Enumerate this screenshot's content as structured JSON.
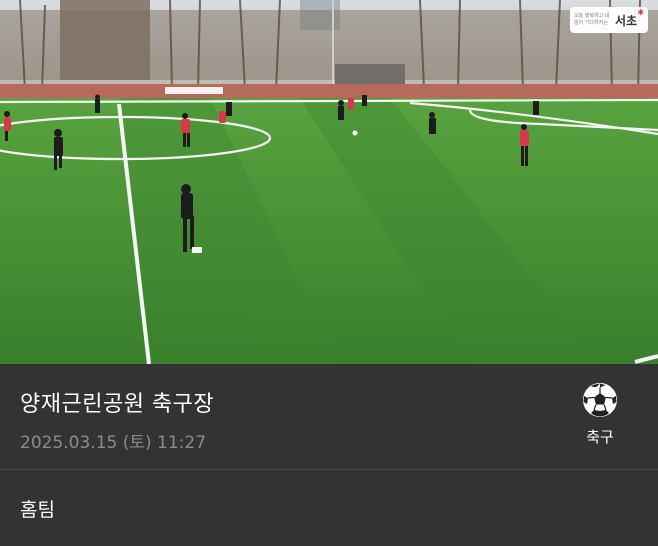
{
  "video": {
    "logo_text_small": "오늘 행복하고 내일이 기다려지는",
    "logo_text_big": "서초"
  },
  "venue": {
    "title": "양재근린공원 축구장",
    "datetime": "2025.03.15 (토) 11:27"
  },
  "sport": {
    "icon": "soccer-ball-icon",
    "label": "축구"
  },
  "section": {
    "label": "홈팀"
  },
  "colors": {
    "background": "#333333",
    "muted_text": "#8b8b8b",
    "pitch": "#3f8a2f",
    "team_red": "#d63a4a"
  }
}
